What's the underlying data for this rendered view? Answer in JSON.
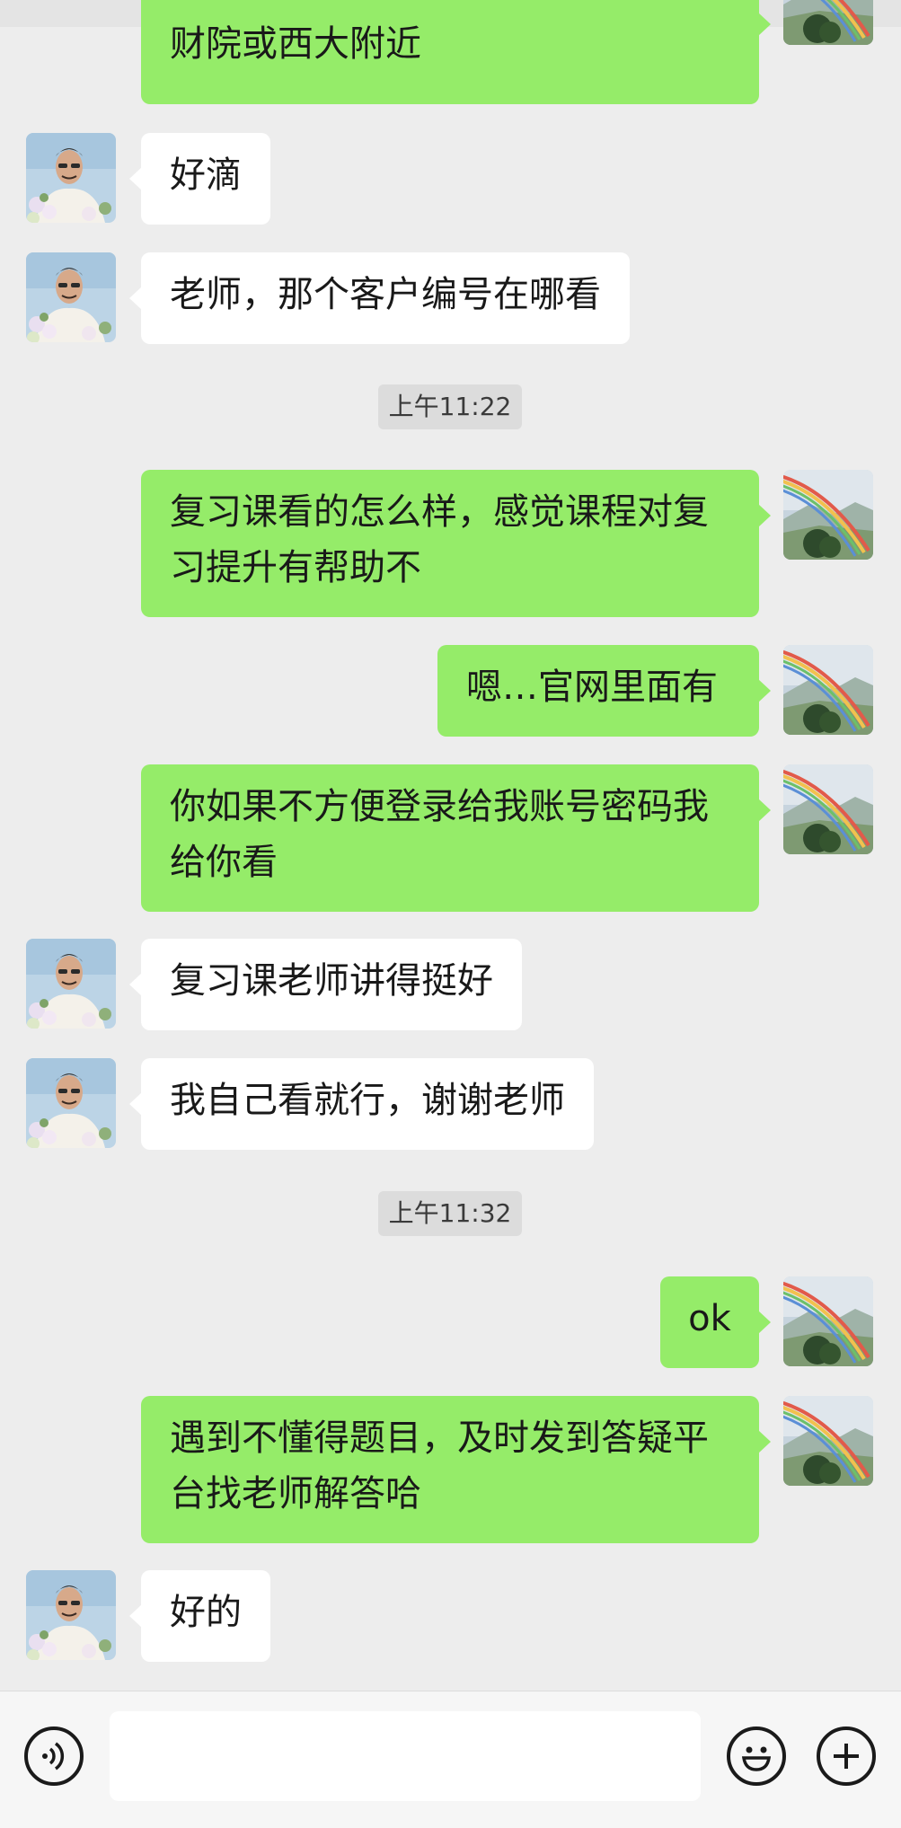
{
  "messages": [
    {
      "side": "out",
      "text": "财院或西大附近"
    },
    {
      "side": "in",
      "text": "好滴"
    },
    {
      "side": "in",
      "text": "老师，那个客户编号在哪看"
    },
    {
      "time": "上午11:22"
    },
    {
      "side": "out",
      "text": "复习课看的怎么样，感觉课程对复\n习提升有帮助不"
    },
    {
      "side": "out",
      "text": "嗯…官网里面有"
    },
    {
      "side": "out",
      "text": "你如果不方便登录给我账号密码我\n给你看"
    },
    {
      "side": "in",
      "text": "复习课老师讲得挺好"
    },
    {
      "side": "in",
      "text": "我自己看就行，谢谢老师"
    },
    {
      "time": "上午11:32"
    },
    {
      "side": "out",
      "text": "ok"
    },
    {
      "side": "out",
      "text": "遇到不懂得题目，及时发到答疑平\n台找老师解答哈"
    },
    {
      "side": "in",
      "text": "好的"
    }
  ],
  "input": {
    "value": "",
    "placeholder": ""
  },
  "icons": {
    "voice": "voice-icon",
    "emoji": "emoji-icon",
    "plus": "plus-icon",
    "contact_avatar": "elderly-man-flowers-avatar",
    "self_avatar": "rainbow-landscape-avatar"
  },
  "colors": {
    "out_bubble": "#95ec69",
    "in_bubble": "#ffffff",
    "background": "#ededed"
  }
}
